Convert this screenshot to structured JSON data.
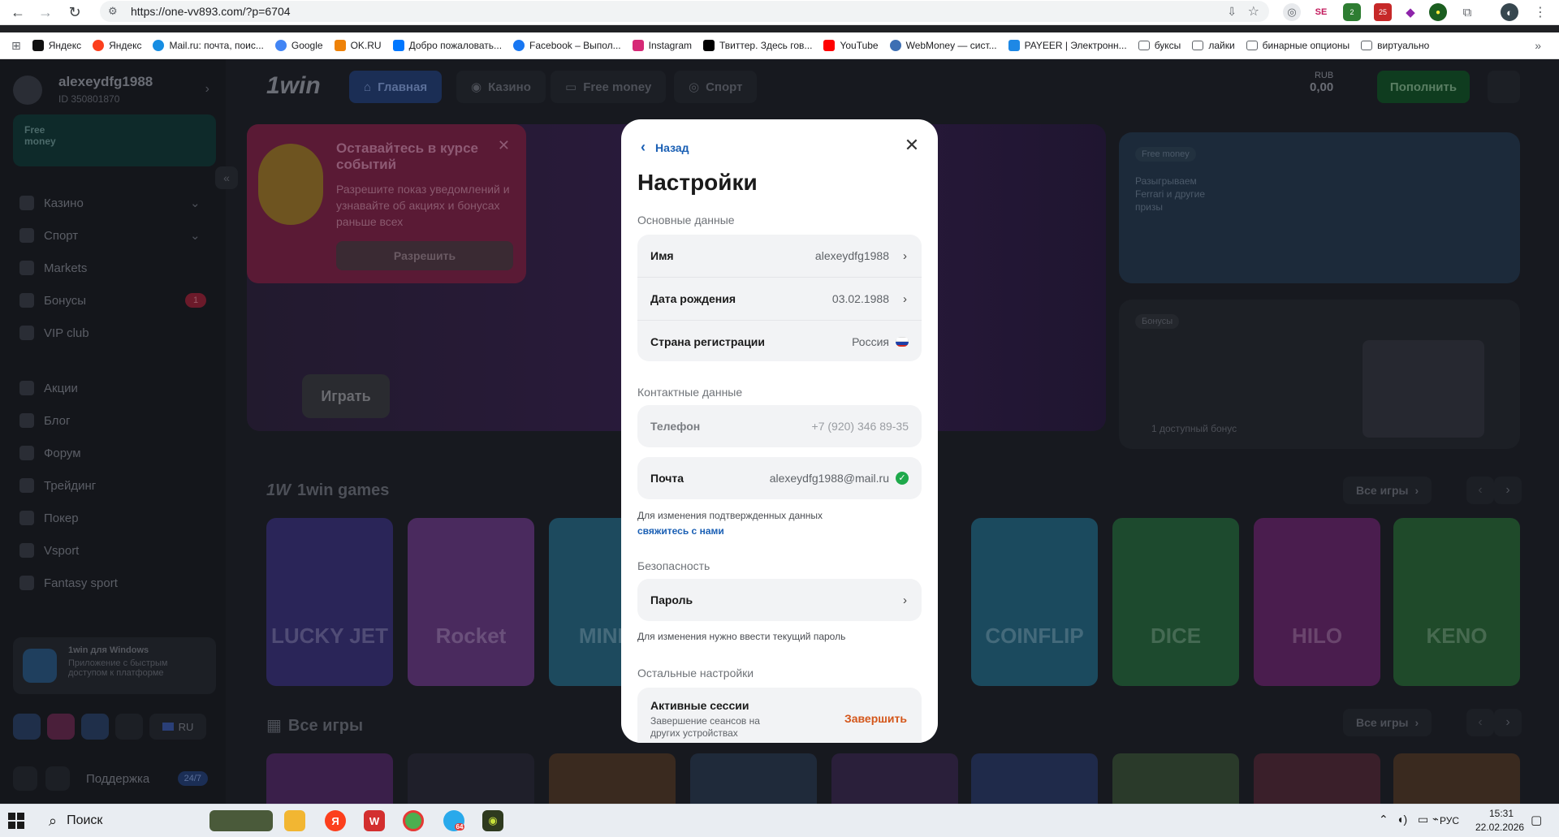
{
  "browser": {
    "url": "https://one-vv893.com/?p=6704",
    "bookmarks": [
      {
        "label": "Яндекс",
        "color": "#111111"
      },
      {
        "label": "Яндекс",
        "color": "#fc3f1d"
      },
      {
        "label": "Mail.ru: почта, поис...",
        "color": "#168de2"
      },
      {
        "label": "Google",
        "color": "#4285f4"
      },
      {
        "label": "OK.RU",
        "color": "#ee8208"
      },
      {
        "label": "Добро пожаловать...",
        "color": "#0077ff"
      },
      {
        "label": "Facebook – Выпол...",
        "color": "#1877f2"
      },
      {
        "label": "Instagram",
        "color": "#d62976"
      },
      {
        "label": "Твиттер. Здесь гов...",
        "color": "#000000"
      },
      {
        "label": "YouTube",
        "color": "#ff0000"
      },
      {
        "label": "WebMoney — сист...",
        "color": "#3d6fb3"
      },
      {
        "label": "PAYEER | Электронн...",
        "color": "#1e88e5"
      },
      {
        "label": "буксы",
        "color": "folder"
      },
      {
        "label": "лайки",
        "color": "folder"
      },
      {
        "label": "бинарные опционы",
        "color": "folder"
      },
      {
        "label": "виртуально",
        "color": "folder"
      }
    ],
    "ext_badges": {
      "a": "2",
      "b": "25"
    }
  },
  "sidebar": {
    "username": "alexeydfg1988",
    "user_id": "ID 350801870",
    "free_money": "Free money",
    "items": [
      {
        "label": "Казино",
        "icon": "casino-icon"
      },
      {
        "label": "Спорт",
        "icon": "sport-icon"
      },
      {
        "label": "Markets",
        "icon": "markets-icon"
      },
      {
        "label": "Бонусы",
        "icon": "gift-icon"
      },
      {
        "label": "VIP club",
        "icon": "crown-icon"
      },
      {
        "label": "Акции",
        "icon": "promo-icon"
      },
      {
        "label": "Блог",
        "icon": "blog-icon"
      },
      {
        "label": "Форум",
        "icon": "forum-icon"
      },
      {
        "label": "Трейдинг",
        "icon": "trading-icon"
      },
      {
        "label": "Покер",
        "icon": "poker-icon"
      },
      {
        "label": "Vsport",
        "icon": "gamepad-icon"
      },
      {
        "label": "Fantasy sport",
        "icon": "trophy-icon"
      }
    ],
    "bonus_count": "1",
    "win_app_title": "1win для Windows",
    "win_app_text": "Приложение с быстрым доступом к платформе",
    "lang": "RU",
    "support": "Поддержка",
    "support_badge": "24/7"
  },
  "header": {
    "logo": "1win",
    "tabs": [
      "Главная",
      "Казино",
      "Free money",
      "Спорт"
    ],
    "currency": "RUB",
    "balance": "0,00",
    "deposit": "Пополнить"
  },
  "notification": {
    "title": "Оставайтесь в курсе событий",
    "text": "Разрешите показ уведомлений и узнавайте об акциях и бонусах раньше всех",
    "button": "Разрешить"
  },
  "promo": {
    "play": "Играть",
    "free_money_tag": "Free money",
    "free_money_text": "Разыгрываем Ferrari и другие призы",
    "bonus_tag": "Бонусы",
    "bonus_text": "1 доступный бонус"
  },
  "games": {
    "section_title": "1win games",
    "all_label": "Все игры",
    "items": [
      "LUCKY JET",
      "Rocket",
      "MINES",
      "COINFLIP",
      "DICE",
      "HILO",
      "KENO"
    ],
    "all_games_title": "Все игры"
  },
  "modal": {
    "back": "Назад",
    "title": "Настройки",
    "basic_section": "Основные данные",
    "name_label": "Имя",
    "name_value": "alexeydfg1988",
    "birth_label": "Дата рождения",
    "birth_value": "03.02.1988",
    "country_label": "Страна регистрации",
    "country_value": "Россия",
    "contact_section": "Контактные данные",
    "phone_label": "Телефон",
    "phone_value": "+7 (920) 346 89-35",
    "email_label": "Почта",
    "email_value": "alexeydfg1988@mail.ru",
    "change_note": "Для изменения подтвержденных данных",
    "contact_link": "свяжитесь с нами",
    "security_section": "Безопасность",
    "password_label": "Пароль",
    "password_note": "Для изменения нужно ввести текущий пароль",
    "other_section": "Остальные настройки",
    "sessions_label": "Активные сессии",
    "sessions_note": "Завершение сеансов на других устройствах",
    "sessions_action": "Завершить"
  },
  "taskbar": {
    "search": "Поиск",
    "lang": "РУС",
    "time": "15:31",
    "date": "22.02.2026",
    "telegram_badge": "64"
  }
}
